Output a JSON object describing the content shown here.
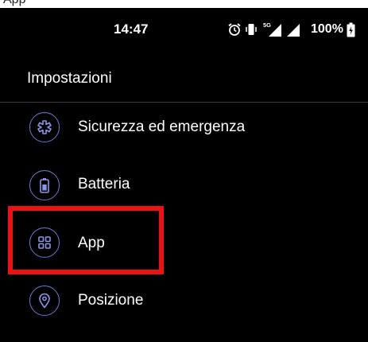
{
  "top_caption": "App",
  "status_bar": {
    "time": "14:47",
    "network": "5G",
    "battery": "100%",
    "icons": [
      "alarm-icon",
      "vibrate-icon",
      "mobile-signal-icon",
      "wifi-signal-icon",
      "battery-icon"
    ]
  },
  "header": {
    "title": "Impostazioni"
  },
  "settings": [
    {
      "label": "Sicurezza ed emergenza",
      "icon": "medical-star-icon"
    },
    {
      "label": "Batteria",
      "icon": "battery-icon"
    },
    {
      "label": "App",
      "icon": "apps-grid-icon"
    },
    {
      "label": "Posizione",
      "icon": "location-pin-icon"
    }
  ],
  "colors": {
    "background": "#000000",
    "accent": "#6b7bd6",
    "highlight": "#ee1111"
  }
}
